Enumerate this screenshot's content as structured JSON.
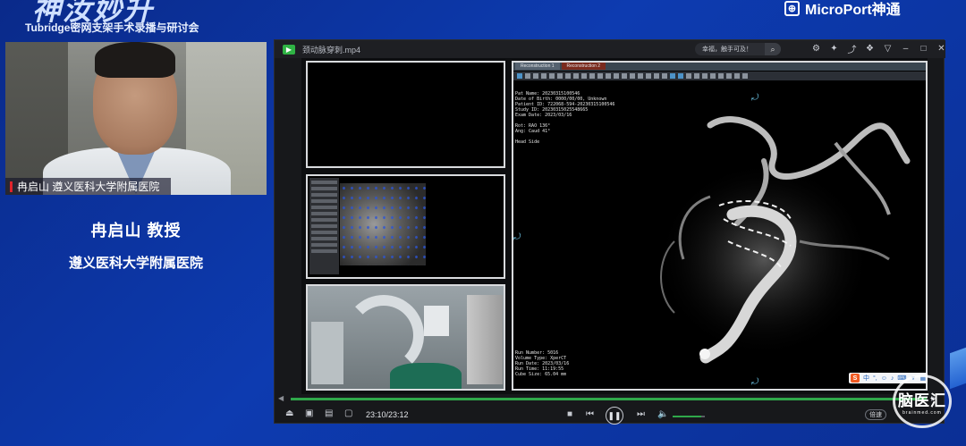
{
  "banner": {
    "event_logo": "神汝妙升",
    "event_subtitle": "Tubridge密网支架手术录播与研讨会",
    "brand_name": "MicroPort神通"
  },
  "speaker": {
    "caption": "冉启山 遵义医科大学附属医院",
    "name": "冉启山 教授",
    "affiliation": "遵义医科大学附属医院"
  },
  "player": {
    "file_name": "颈动脉穿刺.mp4",
    "search_text": "幸福，触手可及！",
    "titlebar_icons": [
      "settings-icon",
      "bulb-icon",
      "share-icon",
      "gift-icon",
      "shirt-icon",
      "minimize-icon",
      "maximize-icon",
      "close-icon"
    ],
    "time": "23:10/23:12",
    "progress": 0.998,
    "volume": 0.9,
    "speed_label": "倍速",
    "colors": {
      "accent": "#2fa84a",
      "background": "#17181b"
    }
  },
  "viewer": {
    "tabs": [
      "Reconstruction 1",
      "Reconstruction 2"
    ],
    "patient_meta": [
      "Pat Name: 20230315100546",
      "Date of Birth: 0000/00/00, Unknown",
      "Patient ID:   722068-594-20230315100546",
      "Study ID:     20230315025548665",
      "Exam Date:    2023/03/16",
      "",
      "Rot: RAO 136°",
      "Ang: Caud  41°",
      "",
      "Head Side"
    ],
    "run_meta": [
      "Run Number:  5016",
      "Volume Type: XperCT",
      "Run Date:    2023/03/16",
      "Run Time:    11:19:55",
      "Cube Size:   65.04 mm"
    ],
    "ime_label": "中"
  },
  "watermark": {
    "text": "脑医汇",
    "sub": "brainmed.com"
  }
}
